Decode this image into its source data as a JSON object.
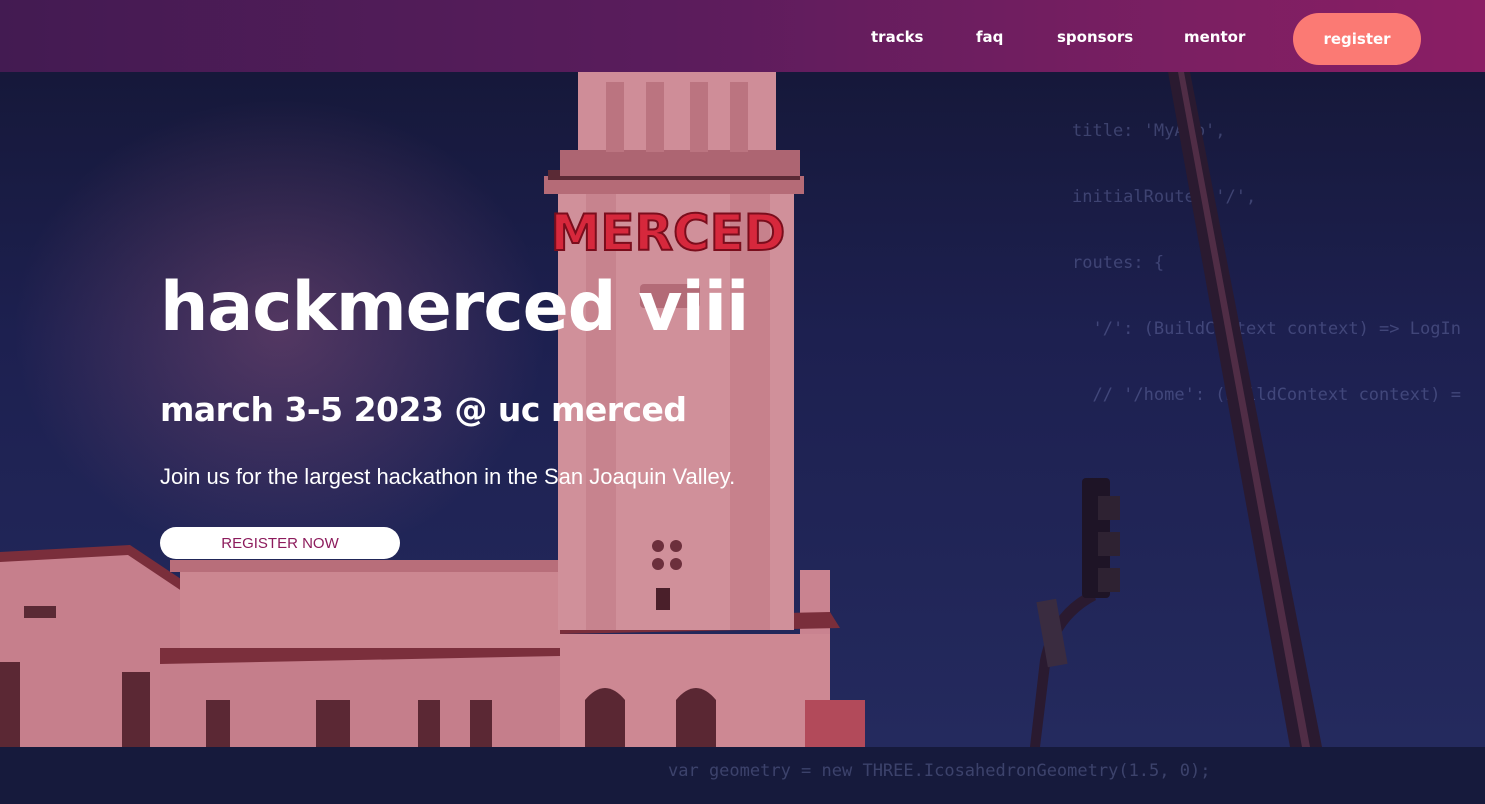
{
  "nav": {
    "links": [
      {
        "label": "tracks"
      },
      {
        "label": "faq"
      },
      {
        "label": "sponsors"
      },
      {
        "label": "mentor"
      }
    ],
    "register_label": "register"
  },
  "hero": {
    "title": "hackmerced viii",
    "date": "march 3-5 2023 @ uc merced",
    "tagline": "Join us for the largest hackathon in the San Joaquin Valley.",
    "cta_label": "REGISTER NOW"
  },
  "background": {
    "sign_text": "MERCED",
    "code_top": [
      "title: 'MyApp',",
      "initialRoute: '/',",
      "routes: {",
      "  '/': (BuildContext context) => LogIn",
      "  // '/home': (BuildContext context) ="
    ],
    "code_bottom": "var geometry = new THREE.IcosahedronGeometry(1.5, 0);"
  },
  "colors": {
    "nav_start": "#431b52",
    "nav_end": "#8a1e64",
    "register_bg": "#fb7a74",
    "cta_text": "#8c1b5c",
    "building": "#d98a93"
  }
}
